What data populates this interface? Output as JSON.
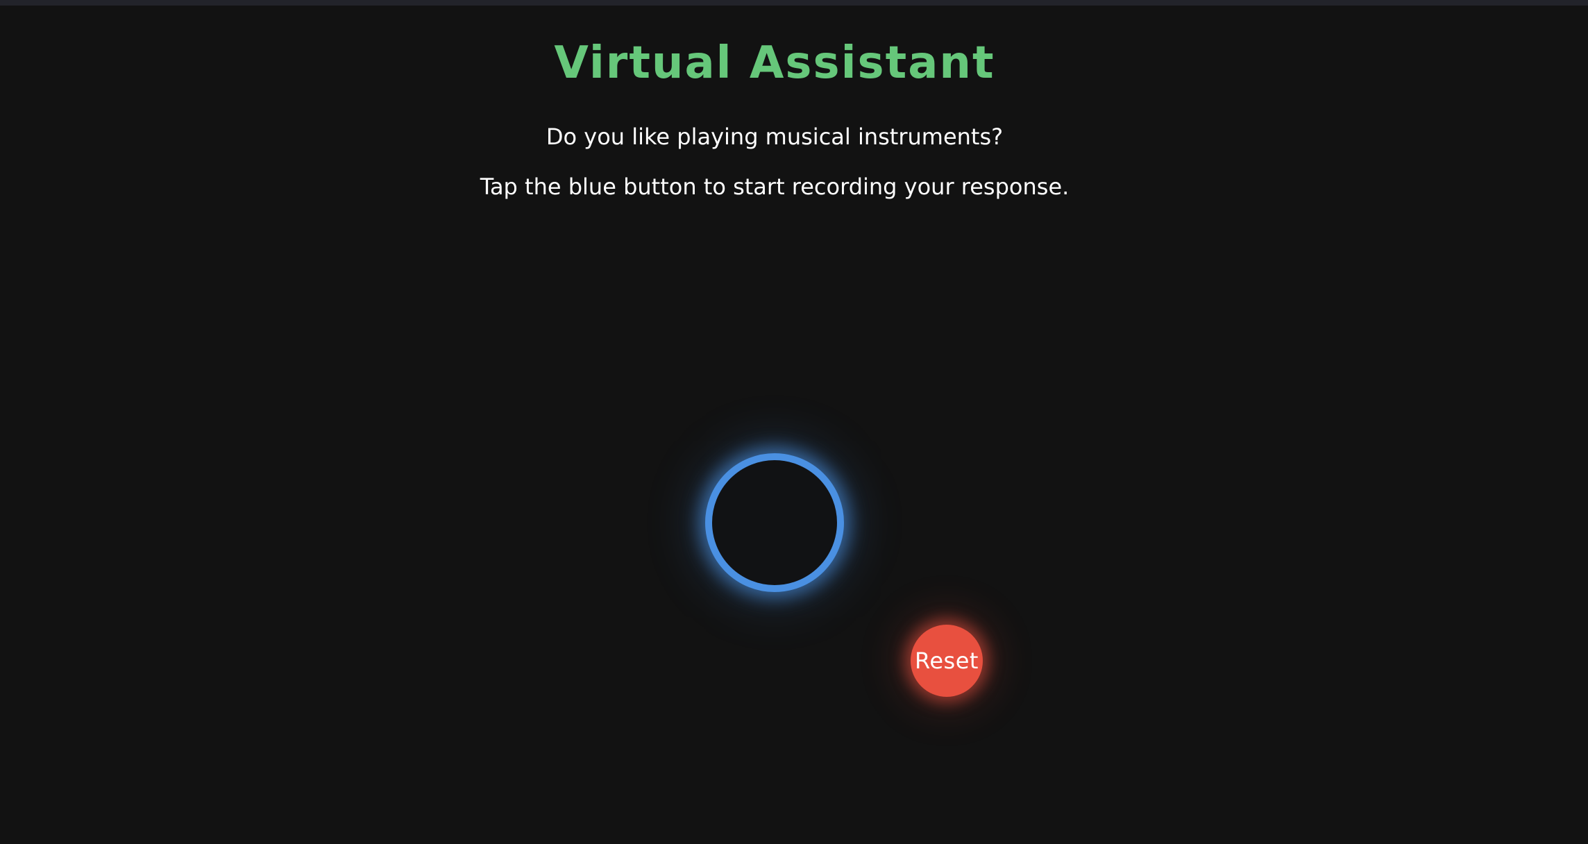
{
  "app": {
    "title": "Virtual Assistant"
  },
  "prompt": {
    "question": "Do you like playing musical instruments?",
    "instruction": "Tap the blue button to start recording your response."
  },
  "controls": {
    "reset_label": "Reset"
  },
  "colors": {
    "background": "#121212",
    "title": "#66c77a",
    "record_ring": "#4a90e2",
    "reset": "#e8503f",
    "text": "#ffffff"
  }
}
